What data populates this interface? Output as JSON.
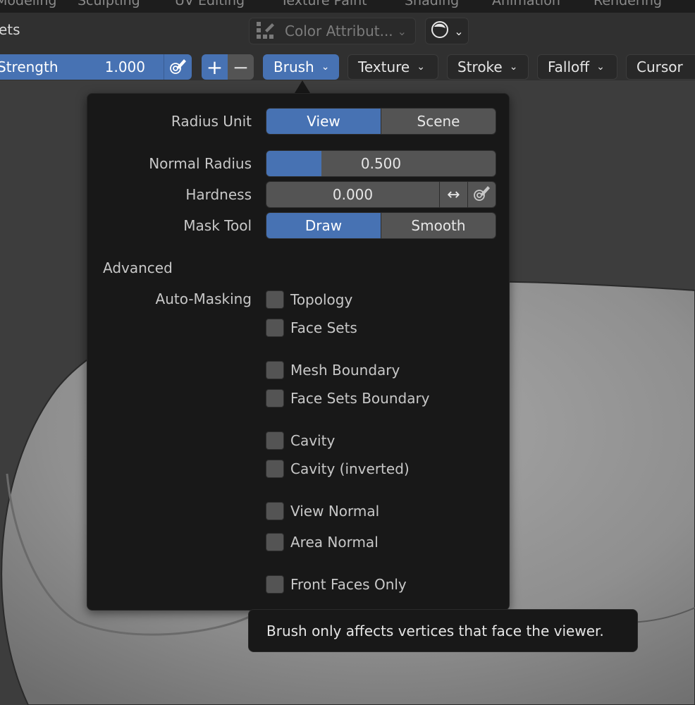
{
  "workspace_tabs": [
    "Modeling",
    "Sculpting",
    "UV Editing",
    "Texture Paint",
    "Shading",
    "Animation",
    "Rendering"
  ],
  "header": {
    "left_text": "ets",
    "color_attribute": "Color Attribut...",
    "icons": {
      "color_attr": "color-attribute-icon",
      "shading": "viewport-shading-icon"
    }
  },
  "toolbar": {
    "strength_label": "Strength",
    "strength_value": "1.000",
    "plus": "+",
    "minus": "−",
    "menus": [
      "Brush",
      "Texture",
      "Stroke",
      "Falloff",
      "Cursor"
    ],
    "active_menu": "Brush"
  },
  "popover": {
    "radius_unit_label": "Radius Unit",
    "radius_unit_options": [
      "View",
      "Scene"
    ],
    "radius_unit_selected": "View",
    "normal_radius_label": "Normal Radius",
    "normal_radius_value": "0.500",
    "normal_radius_fraction": 0.5,
    "hardness_label": "Hardness",
    "hardness_value": "0.000",
    "mask_tool_label": "Mask Tool",
    "mask_tool_options": [
      "Draw",
      "Smooth"
    ],
    "mask_tool_selected": "Draw",
    "advanced_label": "Advanced",
    "auto_masking_label": "Auto-Masking",
    "auto_masking_options": [
      "Topology",
      "Face Sets",
      "Mesh Boundary",
      "Face Sets Boundary",
      "Cavity",
      "Cavity (inverted)",
      "View Normal",
      "Area Normal",
      "Front Faces Only"
    ]
  },
  "tooltip": "Brush only affects vertices that face the viewer.",
  "colors": {
    "accent": "#4772b3",
    "panel": "#181818",
    "widget": "#545454",
    "header": "#303030"
  }
}
